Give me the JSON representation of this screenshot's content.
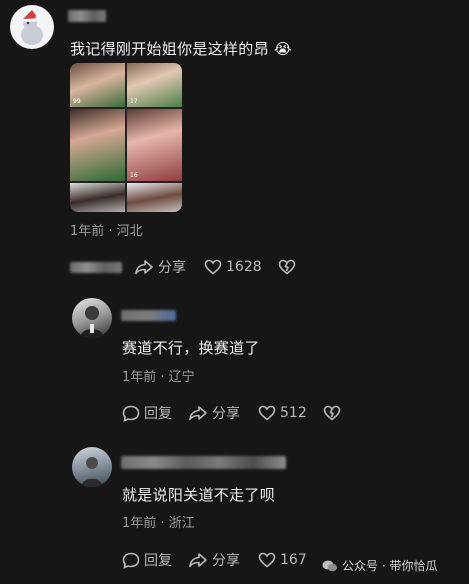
{
  "post": {
    "text": "我记得刚开始姐你是这样的昂",
    "emoji": "😭",
    "meta": "1年前 · 河北",
    "share_label": "分享",
    "like_count": "1628",
    "photos": [
      {
        "count": "99"
      },
      {
        "count": "17"
      },
      {
        "count": ""
      },
      {
        "count": "16"
      },
      {
        "count": ""
      },
      {
        "count": ""
      }
    ]
  },
  "replies": [
    {
      "text": "赛道不行，换赛道了",
      "meta": "1年前 · 辽宁",
      "reply_label": "回复",
      "share_label": "分享",
      "like_count": "512"
    },
    {
      "text": "就是说阳关道不走了呗",
      "meta": "1年前 · 浙江",
      "reply_label": "回复",
      "share_label": "分享",
      "like_count": "167"
    }
  ],
  "watermark": {
    "text": "公众号 · 带你恰瓜"
  },
  "colors": {
    "background": "#171616",
    "text": "#efefef",
    "meta": "#9a9a9a"
  }
}
